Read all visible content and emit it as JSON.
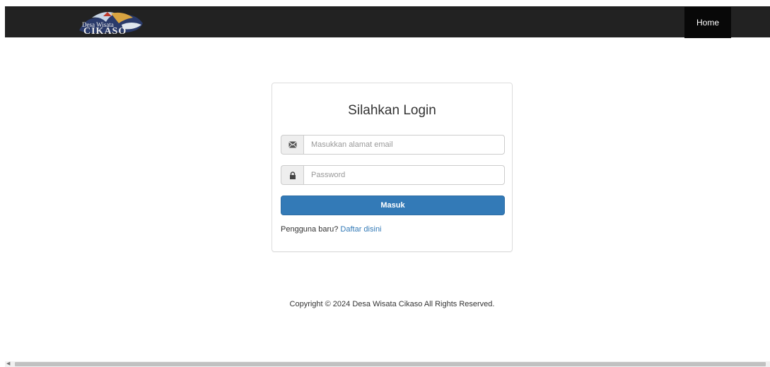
{
  "navbar": {
    "brand_logo": "Desa Wisata Cikaso",
    "home_label": "Home",
    "bg_color": "#222222"
  },
  "login": {
    "title": "Silahkan Login",
    "email_icon": "envelope-icon",
    "email_placeholder": "Masukkan alamat email",
    "password_icon": "lock-icon",
    "password_placeholder": "Password",
    "submit_label": "Masuk",
    "submit_color": "#337ab7",
    "register_prompt": "Pengguna baru?",
    "register_link": "Daftar disini"
  },
  "footer": {
    "copyright": "Copyright © 2024 Desa Wisata Cikaso All Rights Reserved."
  }
}
